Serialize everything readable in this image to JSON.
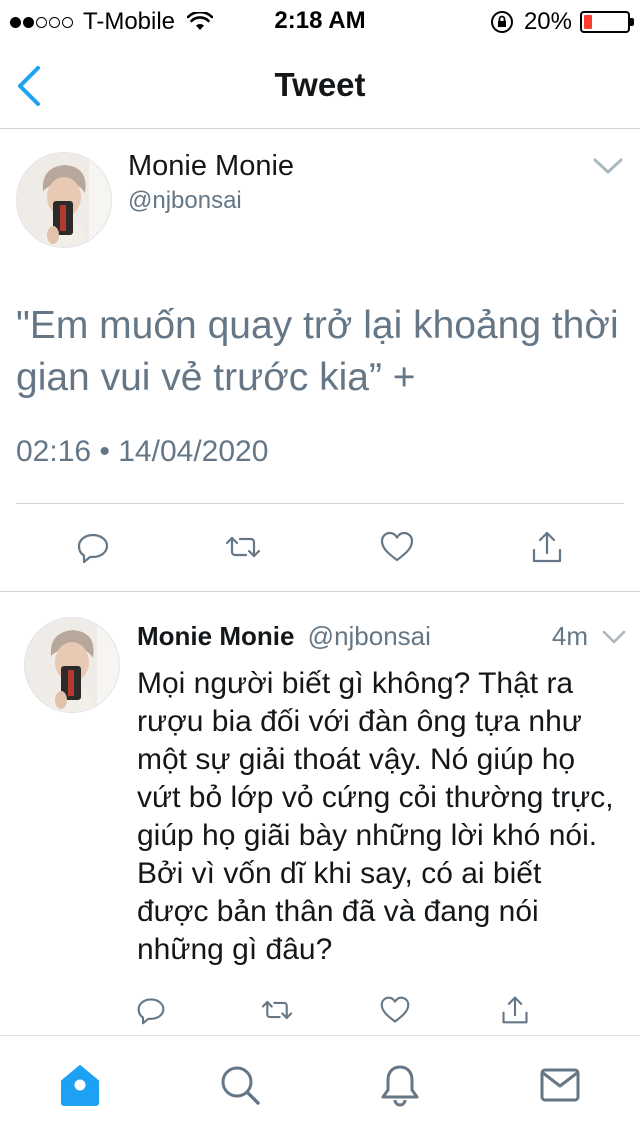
{
  "status_bar": {
    "carrier": "T-Mobile",
    "time": "2:18 AM",
    "battery_percent": "20%",
    "battery_level": 0.2,
    "signal_bars": 2,
    "battery_color": "#ff3b30"
  },
  "nav": {
    "title": "Tweet",
    "back_icon": "chevron-left-icon"
  },
  "main_tweet": {
    "author_name": "Monie Monie",
    "author_handle": "@njbonsai",
    "text": "\"Em muốn quay trở lại khoảng thời gian vui vẻ trước kia” +",
    "timestamp": "02:16 • 14/04/2020",
    "actions": [
      "reply-icon",
      "retweet-icon",
      "like-icon",
      "share-icon"
    ]
  },
  "reply_tweet": {
    "author_name": "Monie Monie",
    "author_handle": "@njbonsai",
    "time_ago": "4m",
    "text": "Mọi người biết gì không? Thật ra rượu bia đối với đàn ông tựa như một sự giải thoát vậy. Nó giúp họ vứt bỏ lớp vỏ cứng cỏi thường trực, giúp họ giãi bày những lời khó nói. Bởi vì vốn dĩ khi say, có ai biết được bản thân đã và đang nói những gì đâu?",
    "actions": [
      "reply-icon",
      "retweet-icon",
      "like-icon",
      "share-icon"
    ]
  },
  "tab_bar": {
    "tabs": [
      "home-icon",
      "search-icon",
      "notifications-icon",
      "messages-icon"
    ],
    "active_tab": "home-icon"
  },
  "colors": {
    "accent": "#1da1f2",
    "secondary_text": "#657786",
    "divider": "#cfd3d6"
  }
}
